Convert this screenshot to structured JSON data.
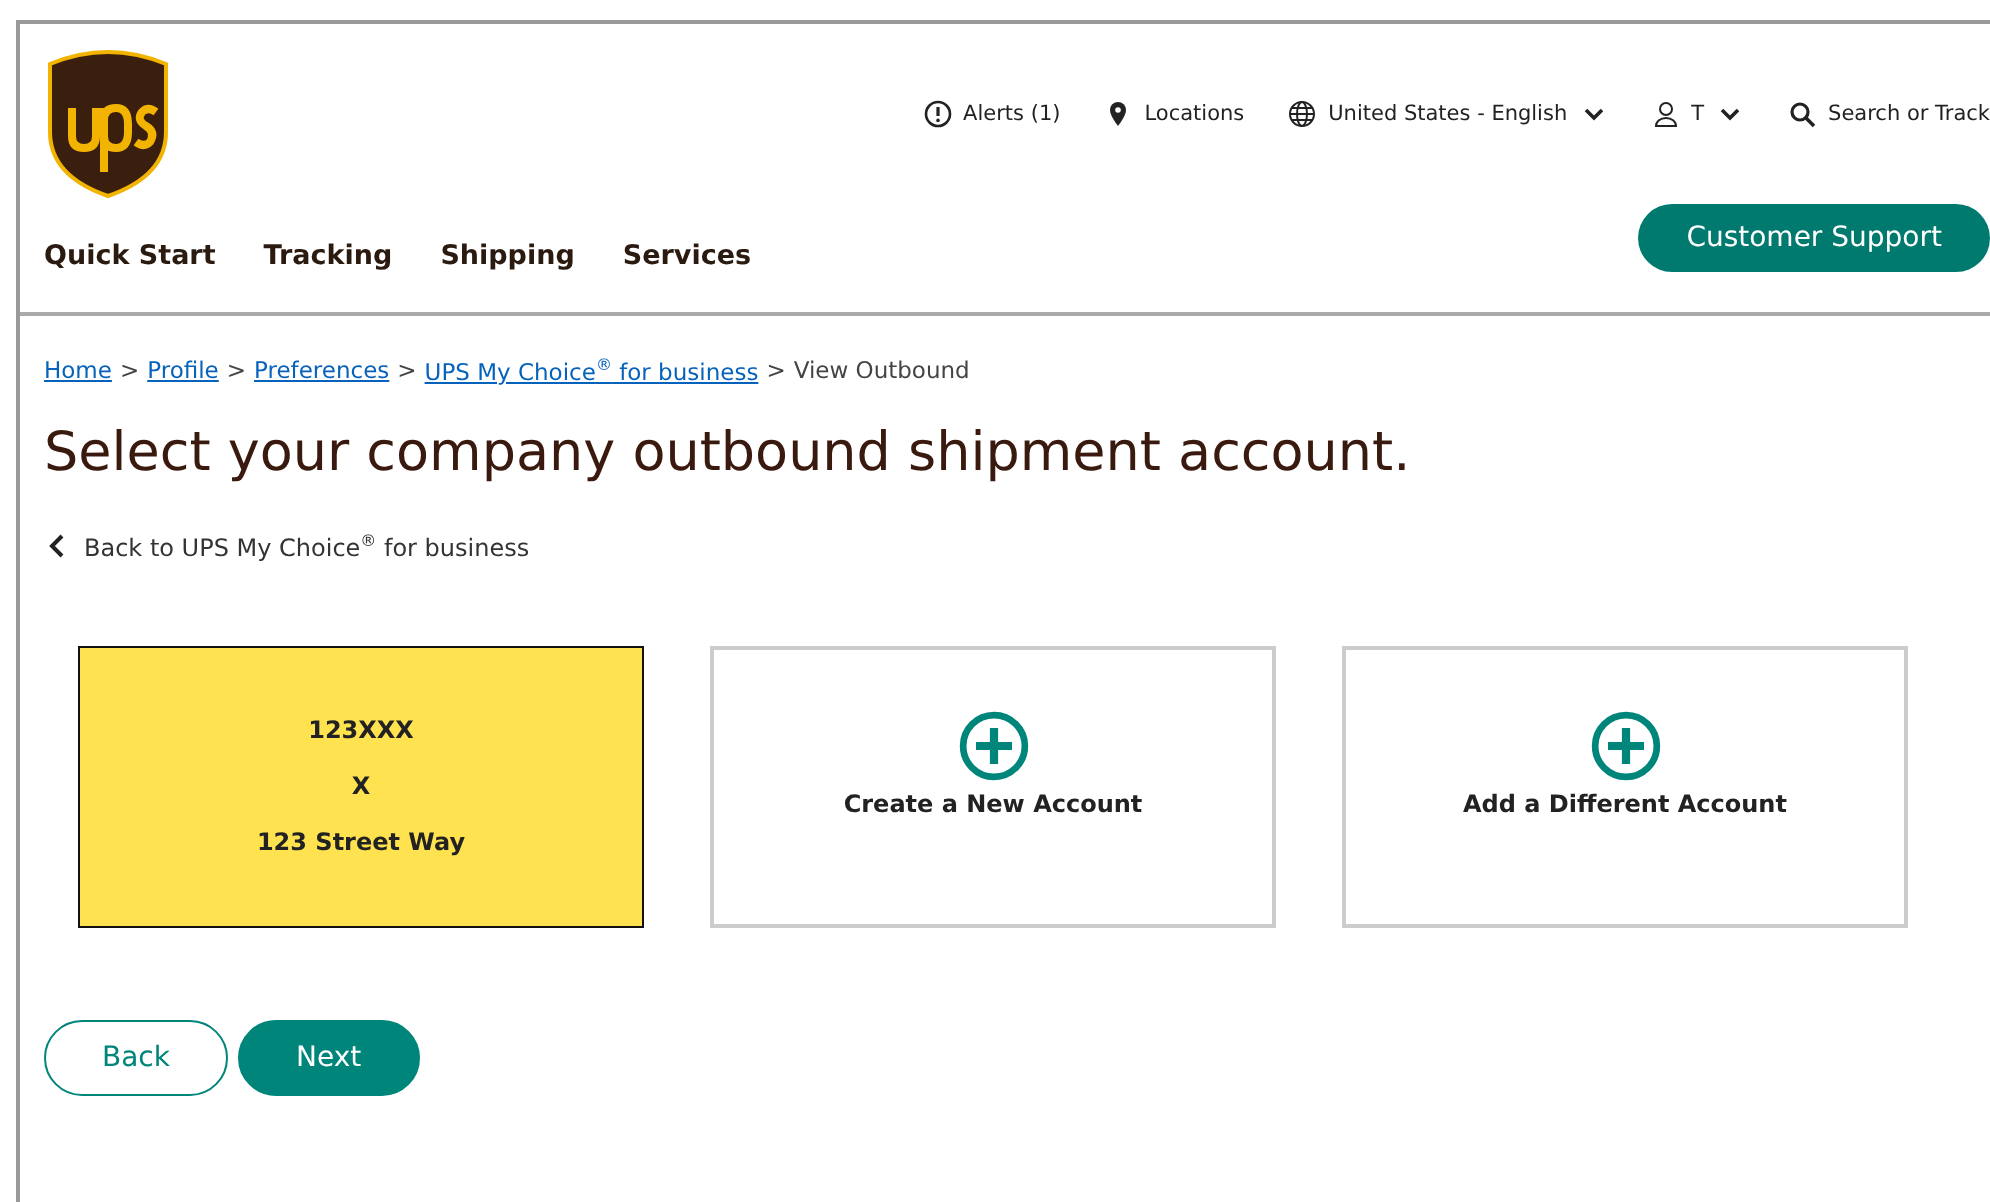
{
  "header": {
    "utility": [
      {
        "kind": "alert",
        "label": "Alerts (1)"
      },
      {
        "kind": "location",
        "label": "Locations"
      },
      {
        "kind": "language",
        "label": "United States - English",
        "dropdown": true
      },
      {
        "kind": "user",
        "label": "T",
        "dropdown": true
      },
      {
        "kind": "search",
        "label": "Search or Track"
      }
    ],
    "nav": [
      "Quick Start",
      "Tracking",
      "Shipping",
      "Services"
    ],
    "support_button": "Customer Support"
  },
  "breadcrumb": [
    {
      "label": "Home",
      "link": true,
      "separator": ">"
    },
    {
      "label": "Profile",
      "link": true,
      "separator": ">"
    },
    {
      "label": "Preferences",
      "link": true,
      "separator": ">"
    },
    {
      "label": "UPS My Choice$^{®}$ for business",
      "link": true,
      "separator": ">"
    },
    {
      "label": "View Outbound",
      "link": false
    }
  ],
  "title": "Select your company outbound shipment account.",
  "back_link": "Back to UPS My Choice$^{®}$ for business",
  "cards": [
    {
      "kind": "account",
      "selected": true,
      "lines": [
        "123XXX",
        "X",
        "123 Street Way"
      ]
    },
    {
      "kind": "action",
      "selected": false,
      "label": "Create a New Account"
    },
    {
      "kind": "action",
      "selected": false,
      "label": "Add a Different Account"
    }
  ],
  "buttons": [
    {
      "label": "Back",
      "primary": false
    },
    {
      "label": "Next",
      "primary": true
    }
  ]
}
